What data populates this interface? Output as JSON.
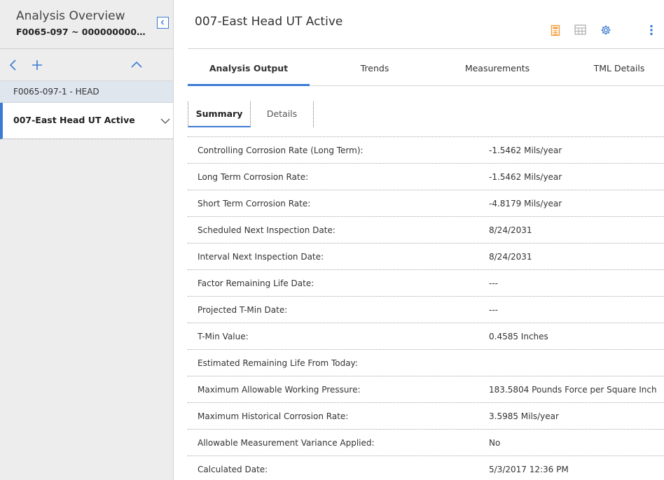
{
  "left": {
    "title": "Analysis Overview",
    "subtitle": "F0065-097 ~ 000000000001...",
    "tree": [
      {
        "label": "F0065-097-1 - HEAD"
      },
      {
        "label": "007-East Head UT Active"
      }
    ]
  },
  "main": {
    "title": "007-East Head UT Active",
    "tabs": [
      {
        "label": "Analysis Output"
      },
      {
        "label": "Trends"
      },
      {
        "label": "Measurements"
      },
      {
        "label": "TML Details"
      }
    ],
    "subtabs": [
      {
        "label": "Summary"
      },
      {
        "label": "Details"
      }
    ],
    "rows": [
      {
        "k": "Controlling Corrosion Rate (Long Term):",
        "v": "-1.5462 Mils/year"
      },
      {
        "k": "Long Term Corrosion Rate:",
        "v": "-1.5462 Mils/year"
      },
      {
        "k": "Short Term Corrosion Rate:",
        "v": "-4.8179 Mils/year"
      },
      {
        "k": "Scheduled Next Inspection Date:",
        "v": "8/24/2031"
      },
      {
        "k": "Interval Next Inspection Date:",
        "v": "8/24/2031"
      },
      {
        "k": "Factor Remaining Life Date:",
        "v": "---"
      },
      {
        "k": "Projected T-Min Date:",
        "v": "---"
      },
      {
        "k": "T-Min Value:",
        "v": "0.4585 Inches"
      },
      {
        "k": "Estimated Remaining Life From Today:",
        "v": ""
      },
      {
        "k": "Maximum Allowable Working Pressure:",
        "v": "183.5804 Pounds Force per Square Inch"
      },
      {
        "k": "Maximum Historical Corrosion Rate:",
        "v": "3.5985 Mils/year"
      },
      {
        "k": "Allowable Measurement Variance Applied:",
        "v": "No"
      },
      {
        "k": "Calculated Date:",
        "v": "5/3/2017 12:36 PM"
      }
    ]
  },
  "icons": {
    "collapse": "collapse-left-icon",
    "back": "chevron-left-icon",
    "add": "plus-icon",
    "up": "chevron-up-icon",
    "expand": "chevron-down-icon",
    "calculator": "calculator-icon",
    "grid": "table-icon",
    "settings": "gear-icon",
    "more": "more-vertical-icon"
  },
  "colors": {
    "accent": "#3b7bd4",
    "calculator": "#f0a040",
    "grid": "#a8a8a8"
  }
}
